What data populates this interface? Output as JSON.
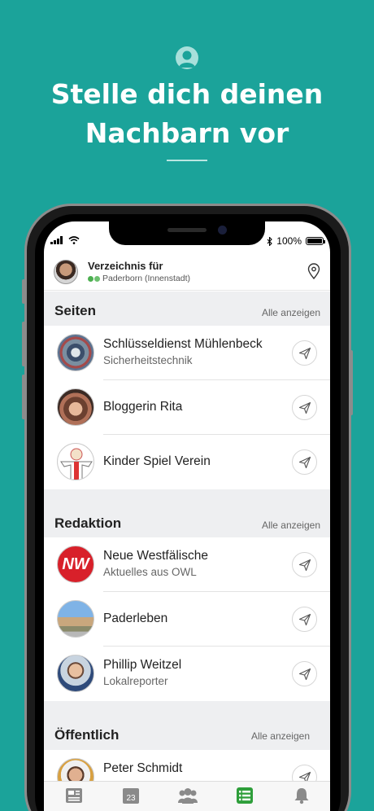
{
  "hero": {
    "title_line1": "Stelle dich deinen",
    "title_line2": "Nachbarn vor"
  },
  "status": {
    "battery": "100%"
  },
  "header": {
    "title": "Verzeichnis für",
    "location": "Paderborn (Innenstadt)"
  },
  "sections": [
    {
      "name": "Seiten",
      "all_label": "Alle anzeigen",
      "rows": [
        {
          "title": "Schlüsseldienst Mühlenbeck",
          "subtitle": "Sicherheitstechnik"
        },
        {
          "title": "Bloggerin Rita",
          "subtitle": ""
        },
        {
          "title": "Kinder Spiel Verein",
          "subtitle": ""
        }
      ]
    },
    {
      "name": "Redaktion",
      "all_label": "Alle anzeigen",
      "rows": [
        {
          "title": "Neue Westfälische",
          "subtitle": "Aktuelles aus OWL"
        },
        {
          "title": "Paderleben",
          "subtitle": ""
        },
        {
          "title": "Phillip Weitzel",
          "subtitle": "Lokalreporter"
        }
      ]
    },
    {
      "name": "Öffentlich",
      "all_label": "Alle anzeigen",
      "rows": [
        {
          "title": "Peter Schmidt",
          "subtitle": ""
        }
      ]
    }
  ],
  "tabbar": {
    "calendar_day": "23",
    "active_tab": "directory",
    "accent": "#2e9e3a"
  },
  "colors": {
    "brand": "#1ba39a"
  },
  "logos": {
    "nw": "NW"
  }
}
